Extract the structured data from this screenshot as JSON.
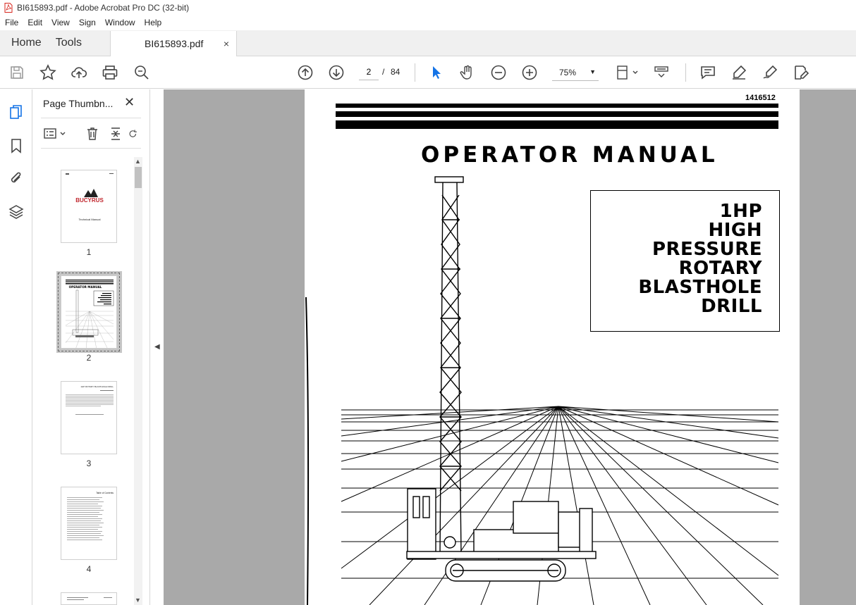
{
  "window": {
    "title": "BI615893.pdf - Adobe Acrobat Pro DC (32-bit)"
  },
  "menu": [
    "File",
    "Edit",
    "View",
    "Sign",
    "Window",
    "Help"
  ],
  "tabs": {
    "home": "Home",
    "tools": "Tools",
    "document": "BI615893.pdf",
    "close": "×"
  },
  "nav": {
    "current_page": "2",
    "separator": "/",
    "total_pages": "84",
    "zoom": "75%"
  },
  "panel": {
    "title": "Page Thumbn...",
    "close": "✕",
    "thumbnails": [
      {
        "page": "1",
        "brand": "BUCYRUS",
        "caption": "Technical Manual"
      },
      {
        "page": "2",
        "caption": "OPERATOR MANUAL"
      },
      {
        "page": "3",
        "caption": "1HP ROTARY BLASTHOLE DRILL"
      },
      {
        "page": "4",
        "caption": "Table of Contents"
      }
    ]
  },
  "document": {
    "doc_id": "1416512",
    "heading": "OPERATOR MANUAL",
    "title_lines": [
      "1HP",
      "HIGH",
      "PRESSURE",
      "ROTARY",
      "BLASTHOLE",
      "DRILL"
    ]
  },
  "colors": {
    "accent": "#1473e6",
    "pdf_red": "#d7261d",
    "doc_background": "#a9a9a9"
  }
}
